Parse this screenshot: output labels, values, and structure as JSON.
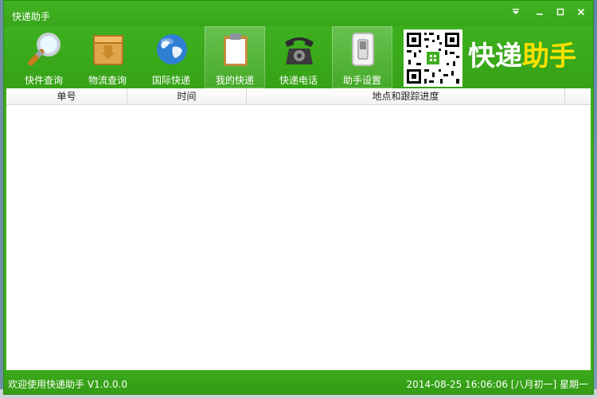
{
  "window": {
    "title": "快递助手",
    "controls": [
      "dropdown",
      "minimize",
      "maximize",
      "close"
    ]
  },
  "toolbar": {
    "items": [
      {
        "label": "快件查询",
        "icon": "magnifier-icon"
      },
      {
        "label": "物流查询",
        "icon": "package-box-icon"
      },
      {
        "label": "国际快递",
        "icon": "globe-icon"
      },
      {
        "label": "我的快递",
        "icon": "clipboard-icon"
      },
      {
        "label": "快递电话",
        "icon": "telephone-icon"
      },
      {
        "label": "助手设置",
        "icon": "switch-icon"
      }
    ],
    "active_index": 3
  },
  "brand": {
    "part1": "快递",
    "part2": "助手"
  },
  "table": {
    "columns": [
      "单号",
      "时间",
      "地点和跟踪进度"
    ],
    "rows": []
  },
  "status": {
    "welcome": "欢迎使用快递助手 V1.0.0.0",
    "datetime": "2014-08-25 16:06:06 [八月初一]  星期一"
  },
  "colors": {
    "theme_green": "#3fae1e",
    "brand_yellow": "#ffe100"
  }
}
